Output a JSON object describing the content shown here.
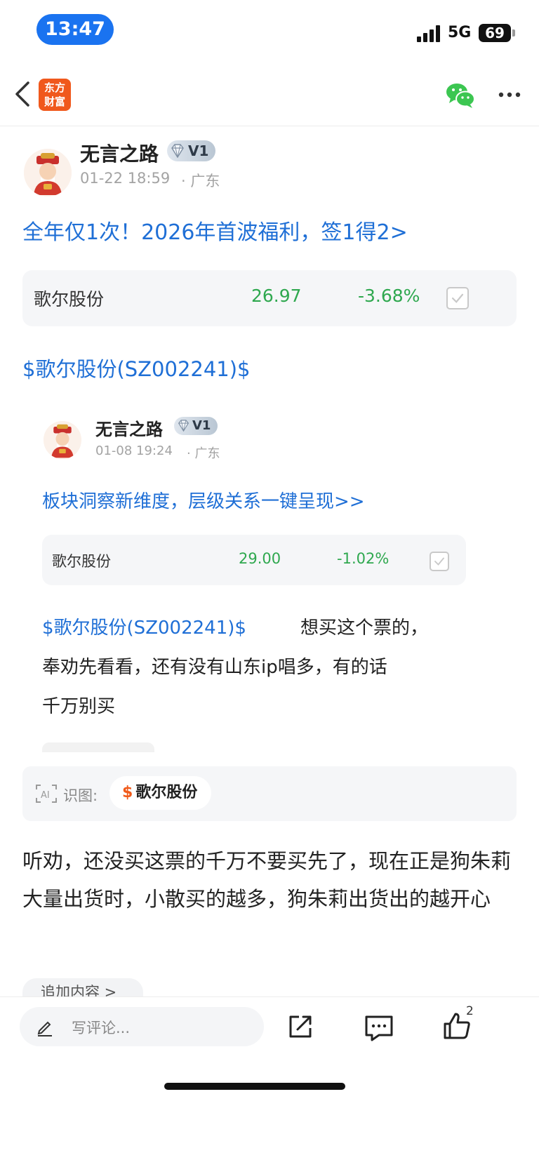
{
  "status_bar": {
    "time": "13:47",
    "network": "5G",
    "battery": "69"
  },
  "nav": {
    "logo_text_1": "东方",
    "logo_text_2": "财富"
  },
  "post": {
    "author": "无言之路",
    "vip_level": "V1",
    "date": "01-22 18:59",
    "location": "· 广东",
    "promo_link": "全年仅1次！2026年首波福利，签1得2>",
    "stock_card": {
      "name": "歌尔股份",
      "price": "26.97",
      "change": "-3.68%"
    },
    "stock_tag": "$歌尔股份(SZ002241)$",
    "quoted": {
      "author": "无言之路",
      "vip_level": "V1",
      "date": "01-08 19:24",
      "location": "· 广东",
      "promo_link": "板块洞察新维度，层级关系一键呈现>>",
      "stock_card": {
        "name": "歌尔股份",
        "price": "29.00",
        "change": "-1.02%"
      },
      "stock_tag": "$歌尔股份(SZ002241)$",
      "text_1": "想买这个票的，",
      "text_2": "奉劝先看看，还有没有山东ip唱多，有的话",
      "text_3": "千万别买"
    },
    "ai_label": "识图:",
    "ai_chip_symbol": "$",
    "ai_chip_text": "歌尔股份",
    "main_text": "听劝，还没买这票的千万不要买先了，现在正是狗朱莉大量出货时，小散买的越多，狗朱莉出货出的越开心",
    "add_content": "追加内容 >"
  },
  "bottom_bar": {
    "comment_placeholder": "写评论...",
    "like_count": "2"
  },
  "colors": {
    "link": "#1f6fd6",
    "stock_green": "#2fa84f",
    "accent": "#f0581c",
    "time_pill": "#1a73f0"
  },
  "icons": [
    "back-icon",
    "wechat-icon",
    "more-icon",
    "diamond-icon",
    "check-icon",
    "ai-scan-icon",
    "pen-icon",
    "share-icon",
    "comment-icon",
    "like-icon"
  ]
}
